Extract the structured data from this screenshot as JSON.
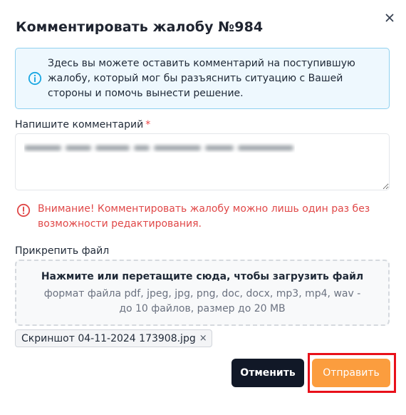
{
  "dialog": {
    "title": "Комментировать жалобу №984",
    "close_icon": "close-icon"
  },
  "info": {
    "icon": "info-circle-icon",
    "text": "Здесь вы можете оставить комментарий на поступившую жалобу, который мог бы разъяснить ситуацию с Вашей стороны и помочь вынести решение."
  },
  "comment": {
    "label": "Напишите комментарий",
    "required_marker": "*"
  },
  "warning": {
    "icon": "alert-circle-icon",
    "text": "Внимание! Комментировать жалобу можно лишь один раз без возможности редактирования."
  },
  "attachment": {
    "label": "Прикрепить файл",
    "dropzone_title": "Нажмите или перетащите сюда, чтобы загрузить файл",
    "dropzone_hint": "формат файла pdf, jpeg, jpg, png, doc, docx, mp3, mp4, wav - до 10 файлов, размер до 20 MB",
    "files": [
      {
        "name": "Скриншот 04-11-2024 173908.jpg",
        "remove": "×"
      }
    ]
  },
  "actions": {
    "cancel_label": "Отменить",
    "submit_label": "Отправить"
  },
  "colors": {
    "accent": "#fb9d3e",
    "dark_button": "#111827",
    "info_bg": "#eef8fe",
    "info_border": "#8fd0ef",
    "warning": "#e04848",
    "highlight": "#e8101a"
  }
}
